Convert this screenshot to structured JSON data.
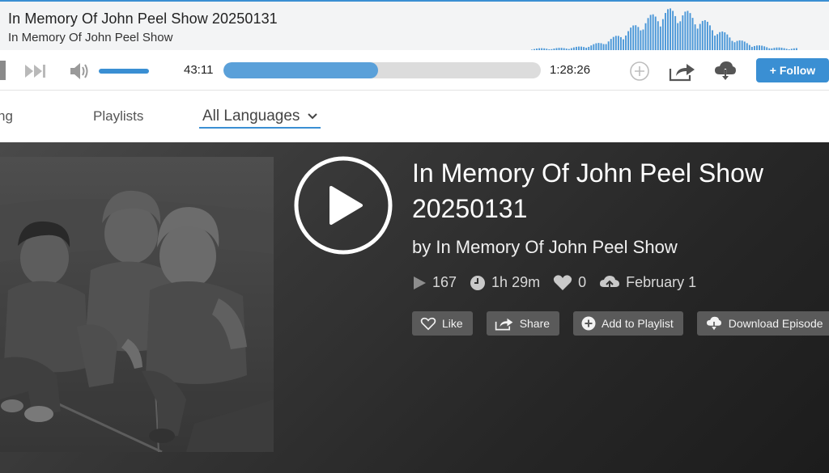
{
  "player": {
    "title": "In Memory Of John Peel Show 20250131",
    "subtitle": "In Memory Of John Peel Show",
    "elapsed": "43:11",
    "duration": "1:28:26",
    "progress_fraction": 0.488,
    "volume_fraction": 1.0,
    "follow_label": "+ Follow"
  },
  "nav": {
    "partial_item": "ng",
    "playlists_label": "Playlists",
    "language_selected": "All Languages"
  },
  "episode": {
    "title": "In Memory Of John Peel Show 20250131",
    "by_line": "by In Memory Of John Peel Show",
    "plays": "167",
    "duration": "1h 29m",
    "likes": "0",
    "date": "February 1",
    "actions": {
      "like": "Like",
      "share": "Share",
      "add_to_playlist": "Add to Playlist",
      "download": "Download Episode"
    }
  },
  "icons": [
    "skip-next-icon",
    "volume-icon",
    "add-circle-icon",
    "share-icon",
    "cloud-download-icon",
    "chevron-down-icon",
    "play-icon",
    "clock-icon",
    "heart-icon",
    "cloud-upload-icon"
  ],
  "colors": {
    "accent": "#3a8fd3",
    "progress_fill": "#5aa0d9",
    "hero_bg": "#2e2e2e",
    "button_bg": "#5a5a5a"
  }
}
